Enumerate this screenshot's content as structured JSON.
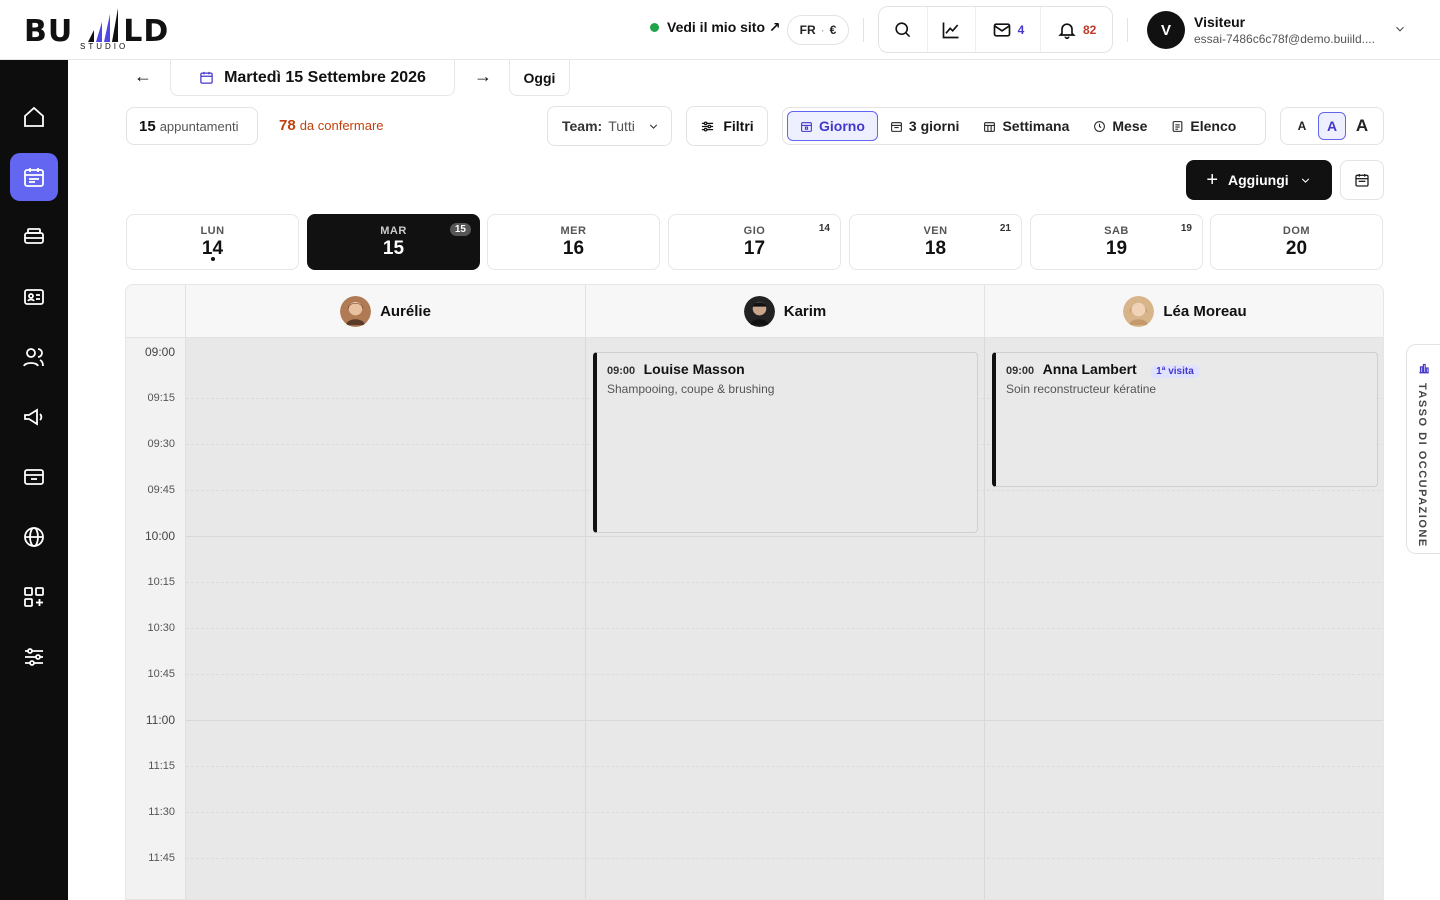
{
  "header": {
    "logo_text_left": "BU",
    "logo_text_right": "LD",
    "logo_sub": "STUDIO",
    "site_link": "Vedi il mio sito ↗",
    "lang": "FR",
    "currency": "€",
    "messages_count": "4",
    "notifications_count": "82",
    "user": {
      "initial": "V",
      "name": "Visiteur",
      "email": "essai-7486c6c78f@demo.buiild...."
    }
  },
  "toolbar": {
    "date_label": "Martedì 15 Settembre 2026",
    "prev_arrow": "←",
    "next_arrow": "→",
    "today_label": "Oggi",
    "appointments_count": "15",
    "appointments_label": "appuntamenti",
    "to_confirm_count": "78",
    "to_confirm_label": "da confermare",
    "team_label": "Team:",
    "team_value": "Tutti",
    "filters_label": "Filtri",
    "views": {
      "day": "Giorno",
      "three_days": "3 giorni",
      "week": "Settimana",
      "month": "Mese",
      "list": "Elenco"
    },
    "font_sizes": [
      "A",
      "A",
      "A"
    ],
    "add_label": "Aggiungi"
  },
  "week_days": [
    {
      "name": "LUN",
      "date": "14",
      "count": ""
    },
    {
      "name": "MAR",
      "date": "15",
      "count": "15"
    },
    {
      "name": "MER",
      "date": "16",
      "count": ""
    },
    {
      "name": "GIO",
      "date": "17",
      "count": "14"
    },
    {
      "name": "VEN",
      "date": "18",
      "count": "21"
    },
    {
      "name": "SAB",
      "date": "19",
      "count": "19"
    },
    {
      "name": "DOM",
      "date": "20",
      "count": ""
    }
  ],
  "staff": [
    {
      "name": "Aurélie"
    },
    {
      "name": "Karim"
    },
    {
      "name": "Léa Moreau"
    }
  ],
  "time_labels": [
    "09:00",
    "09:15",
    "09:30",
    "09:45",
    "10:00",
    "10:15",
    "10:30",
    "10:45",
    "11:00",
    "11:15",
    "11:30",
    "11:45"
  ],
  "appointments": [
    {
      "time": "09:00",
      "client": "Louise Masson",
      "service": "Shampooing, coupe & brushing",
      "tag": ""
    },
    {
      "time": "09:00",
      "client": "Anna Lambert",
      "service": "Soin reconstructeur kératine",
      "tag": "1ª visita"
    }
  ],
  "occupancy_label": "TASSO DI OCCUPAZIONE",
  "colors": {
    "accent": "#6366f1",
    "accent_dark": "#4338ca",
    "orange": "#c2410c",
    "sidebar": "#0d0d0d"
  }
}
